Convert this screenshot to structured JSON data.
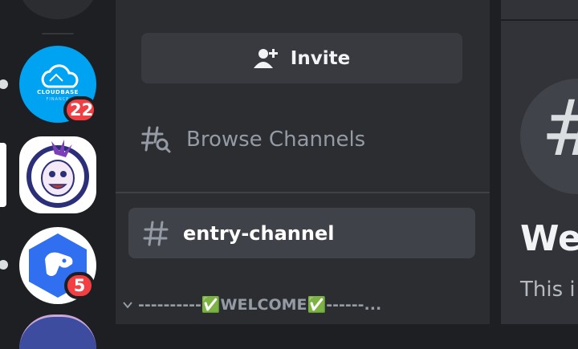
{
  "servers": [
    {
      "name": "cloudbase-server",
      "brand": "CLOUDBASE",
      "sub": "FINANCE",
      "badge": "22"
    },
    {
      "name": "mascot-server",
      "badge": ""
    },
    {
      "name": "dog-server",
      "badge": "5"
    }
  ],
  "channels": {
    "invite_label": "Invite",
    "browse_label": "Browse Channels",
    "selected_channel": "entry-channel",
    "category_label": "----------✅WELCOME✅------..."
  },
  "main": {
    "title": "We",
    "subtitle": "This i"
  },
  "colors": {
    "rail_bg": "#1e1f22",
    "panel_bg": "#2b2d31",
    "selected_bg": "#404249",
    "badge_red": "#f23f43",
    "cloud_blue": "#00a2f2",
    "dog_blue": "#2f6ff0"
  }
}
